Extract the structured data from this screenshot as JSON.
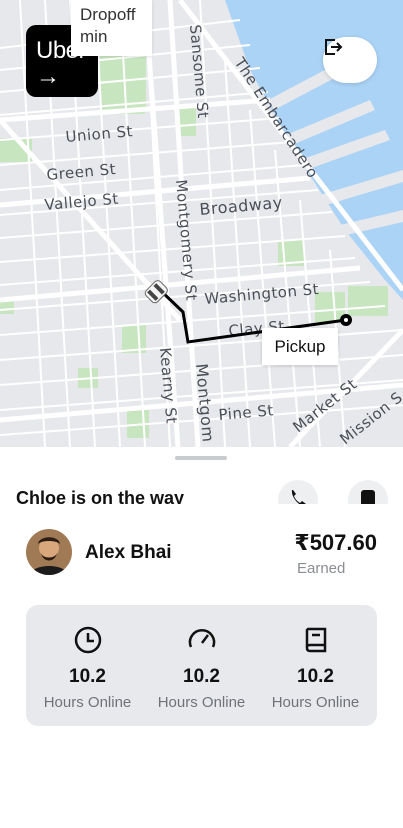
{
  "map": {
    "streets": {
      "union": "Union St",
      "green": "Green St",
      "vallejo": "Vallejo St",
      "broadway": "Broadway",
      "sansome": "Sansome St",
      "embarcadero": "The Embarcadero",
      "montgomery_upper": "Montgomery St",
      "montgomery_lower": "Montgom",
      "washington": "Washington St",
      "clay": "Clay St",
      "kearny": "Kearny St",
      "pine": "Pine St",
      "market": "Market St",
      "mission": "Mission S"
    },
    "dropoff": {
      "line1": "Dropoff",
      "line2": "min"
    },
    "pickup_label": "Pickup"
  },
  "brand": {
    "word": "Uber",
    "arrow": "→"
  },
  "sheet": {
    "status": "Chloe is on the way",
    "driver": {
      "name": "Alex Bhai"
    },
    "earnings": {
      "amount": "₹507.60",
      "label": "Earned"
    },
    "stats": [
      {
        "icon": "clock-icon",
        "value": "10.2",
        "label": "Hours Online"
      },
      {
        "icon": "speedometer-icon",
        "value": "10.2",
        "label": "Hours Online"
      },
      {
        "icon": "book-icon",
        "value": "10.2",
        "label": "Hours Online"
      }
    ]
  },
  "colors": {
    "map_land": "#e7e8ec",
    "map_water": "#aad3f6",
    "map_park": "#c7e6bf",
    "route": "#000000",
    "card_bg": "#e8e9ed"
  }
}
